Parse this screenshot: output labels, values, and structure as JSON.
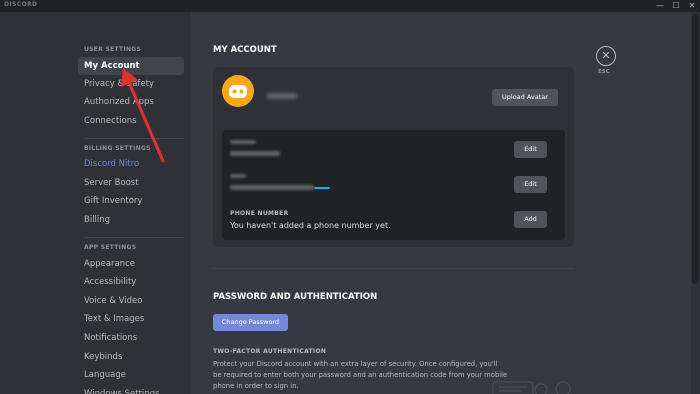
{
  "window": {
    "title": "DISCORD",
    "controls": {
      "minimize": "—",
      "maximize": "☐",
      "close": "✕"
    }
  },
  "sidebar": {
    "user_settings_header": "USER SETTINGS",
    "user_items": [
      "My Account",
      "Privacy & Safety",
      "Authorized Apps",
      "Connections"
    ],
    "billing_header": "BILLING SETTINGS",
    "billing_items": [
      "Discord Nitro",
      "Server Boost",
      "Gift Inventory",
      "Billing"
    ],
    "app_header": "APP SETTINGS",
    "app_items": [
      "Appearance",
      "Accessibility",
      "Voice & Video",
      "Text & Images",
      "Notifications",
      "Keybinds",
      "Language",
      "Windows Settings"
    ]
  },
  "main": {
    "account_title": "MY ACCOUNT",
    "upload_avatar": "Upload Avatar",
    "edit_label": "Edit",
    "phone_label": "PHONE NUMBER",
    "phone_text": "You haven't added a phone number yet.",
    "add_label": "Add",
    "password_title": "PASSWORD AND AUTHENTICATION",
    "change_password": "Change Password",
    "tfa_label": "TWO-FACTOR AUTHENTICATION",
    "tfa_text_1": "Protect your Discord account with an extra layer of security. Once configured, you'll",
    "tfa_text_2": "be required to enter both your password and an authentication code from your mobile",
    "tfa_text_3": "phone in order to sign in."
  },
  "close": {
    "label": "ESC",
    "icon": "close-icon"
  },
  "colors": {
    "accent": "#7289da",
    "annotation_arrow": "#e03131",
    "avatar": "#faa61a",
    "link": "#00b0f4"
  }
}
